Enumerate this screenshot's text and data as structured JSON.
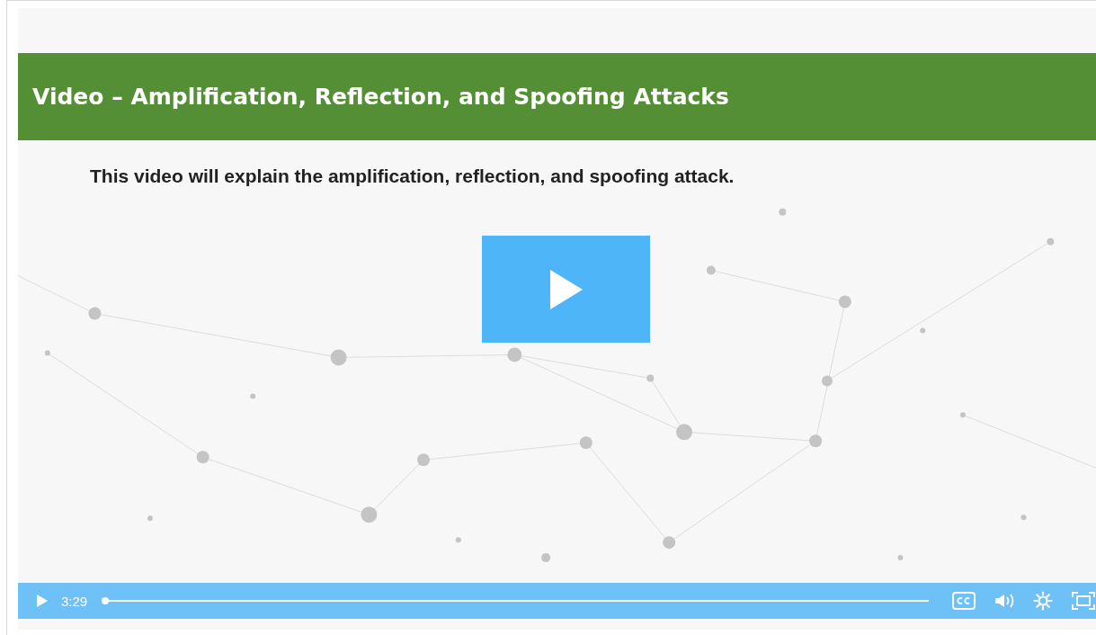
{
  "slide": {
    "title": "Video – Amplification, Reflection, and Spoofing Attacks",
    "subtitle": "This video will explain the amplification, reflection, and spoofing attack."
  },
  "player": {
    "playing": false,
    "time": "3:29",
    "level": 0.0
  }
}
